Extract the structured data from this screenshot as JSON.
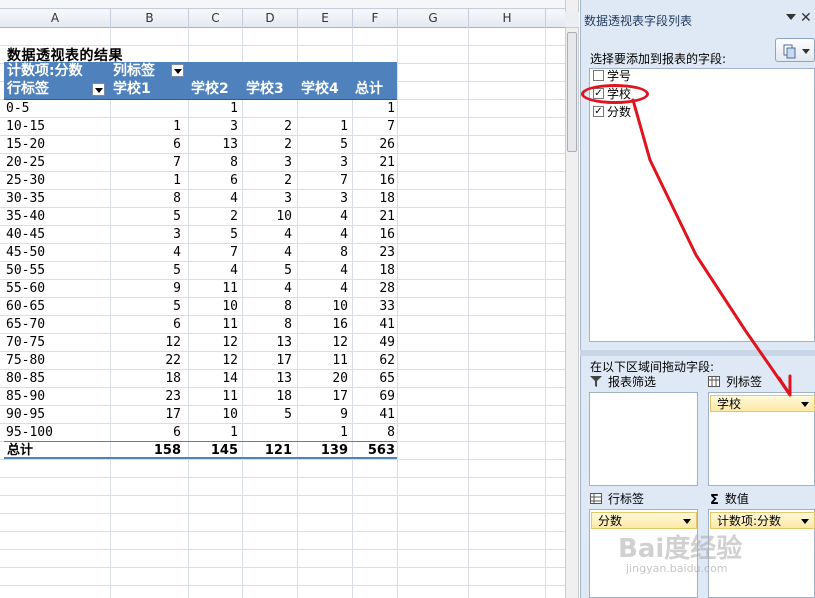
{
  "sheet": {
    "columns": [
      "A",
      "B",
      "C",
      "D",
      "E",
      "F",
      "G",
      "H"
    ],
    "pivot_title": "数据透视表的结果",
    "header1": {
      "measure": "计数项:分数",
      "col_label": "列标签"
    },
    "header2": {
      "row_label": "行标签",
      "cols": [
        "学校1",
        "学校2",
        "学校3",
        "学校4",
        "总计"
      ]
    },
    "rows": [
      [
        "0-5",
        "",
        "1",
        "",
        "",
        "1"
      ],
      [
        "10-15",
        "1",
        "3",
        "2",
        "1",
        "7"
      ],
      [
        "15-20",
        "6",
        "13",
        "2",
        "5",
        "26"
      ],
      [
        "20-25",
        "7",
        "8",
        "3",
        "3",
        "21"
      ],
      [
        "25-30",
        "1",
        "6",
        "2",
        "7",
        "16"
      ],
      [
        "30-35",
        "8",
        "4",
        "3",
        "3",
        "18"
      ],
      [
        "35-40",
        "5",
        "2",
        "10",
        "4",
        "21"
      ],
      [
        "40-45",
        "3",
        "5",
        "4",
        "4",
        "16"
      ],
      [
        "45-50",
        "4",
        "7",
        "4",
        "8",
        "23"
      ],
      [
        "50-55",
        "5",
        "4",
        "5",
        "4",
        "18"
      ],
      [
        "55-60",
        "9",
        "11",
        "4",
        "4",
        "28"
      ],
      [
        "60-65",
        "5",
        "10",
        "8",
        "10",
        "33"
      ],
      [
        "65-70",
        "6",
        "11",
        "8",
        "16",
        "41"
      ],
      [
        "70-75",
        "12",
        "12",
        "13",
        "12",
        "49"
      ],
      [
        "75-80",
        "22",
        "12",
        "17",
        "11",
        "62"
      ],
      [
        "80-85",
        "18",
        "14",
        "13",
        "20",
        "65"
      ],
      [
        "85-90",
        "23",
        "11",
        "18",
        "17",
        "69"
      ],
      [
        "90-95",
        "17",
        "10",
        "5",
        "9",
        "41"
      ],
      [
        "95-100",
        "6",
        "1",
        "",
        "1",
        "8"
      ]
    ],
    "total": [
      "总计",
      "158",
      "145",
      "121",
      "139",
      "563"
    ]
  },
  "pane": {
    "title": "数据透视表字段列表",
    "close": "✕",
    "choose_label": "选择要添加到报表的字段:",
    "fields": [
      {
        "name": "学号",
        "checked": ""
      },
      {
        "name": "学校",
        "checked": "✓"
      },
      {
        "name": "分数",
        "checked": "✓"
      }
    ],
    "drag_label": "在以下区域间拖动字段:",
    "zones": {
      "filter": {
        "title": "报表筛选"
      },
      "columns": {
        "title": "列标签",
        "chip": "学校"
      },
      "rows": {
        "title": "行标签",
        "chip": "分数"
      },
      "values": {
        "title": "数值",
        "chip": "计数项:分数"
      }
    }
  },
  "watermark": {
    "text": "Bai度经验",
    "sub": "jingyan.baidu.com"
  },
  "colors": {
    "pivot_header": "#4f81bd",
    "annotation": "#e0141e",
    "chip": "#fde9a5"
  }
}
